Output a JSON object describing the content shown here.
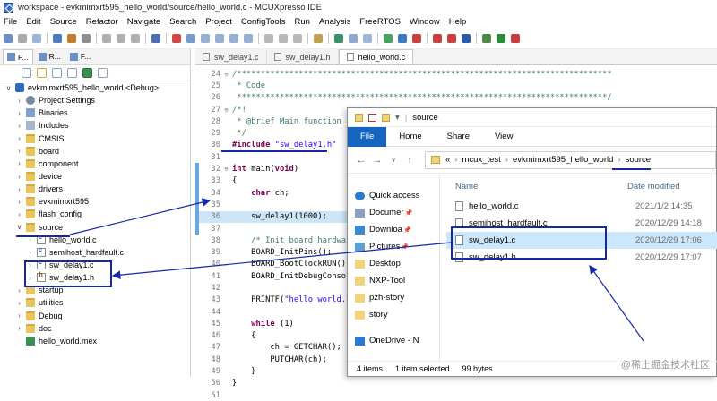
{
  "ide": {
    "title": "workspace - evkmimxrt595_hello_world/source/hello_world.c - MCUXpresso IDE",
    "menu": [
      "File",
      "Edit",
      "Source",
      "Refactor",
      "Navigate",
      "Search",
      "Project",
      "ConfigTools",
      "Run",
      "Analysis",
      "FreeRTOS",
      "Window",
      "Help"
    ]
  },
  "left_panel": {
    "tabs": [
      {
        "label": "P..."
      },
      {
        "label": "R..."
      },
      {
        "label": "F..."
      }
    ],
    "tree": [
      {
        "label": "evkmimxrt595_hello_world <Debug>",
        "indent": 0,
        "caret": "v",
        "icon": "proj"
      },
      {
        "label": "Project Settings",
        "indent": 1,
        "caret": ">",
        "icon": "gear"
      },
      {
        "label": "Binaries",
        "indent": 1,
        "caret": ">",
        "icon": "bin"
      },
      {
        "label": "Includes",
        "indent": 1,
        "caret": ">",
        "icon": "inc"
      },
      {
        "label": "CMSIS",
        "indent": 1,
        "caret": ">",
        "icon": "folder"
      },
      {
        "label": "board",
        "indent": 1,
        "caret": ">",
        "icon": "folder"
      },
      {
        "label": "component",
        "indent": 1,
        "caret": ">",
        "icon": "folder"
      },
      {
        "label": "device",
        "indent": 1,
        "caret": ">",
        "icon": "folder"
      },
      {
        "label": "drivers",
        "indent": 1,
        "caret": ">",
        "icon": "folder"
      },
      {
        "label": "evkmimxrt595",
        "indent": 1,
        "caret": ">",
        "icon": "folder"
      },
      {
        "label": "flash_config",
        "indent": 1,
        "caret": ">",
        "icon": "folder"
      },
      {
        "label": "source",
        "indent": 1,
        "caret": "v",
        "icon": "srcfolder"
      },
      {
        "label": "hello_world.c",
        "indent": 2,
        "caret": ">",
        "icon": "file"
      },
      {
        "label": "semihost_hardfault.c",
        "indent": 2,
        "caret": ">",
        "icon": "file"
      },
      {
        "label": "sw_delay1.c",
        "indent": 2,
        "caret": ">",
        "icon": "file"
      },
      {
        "label": "sw_delay1.h",
        "indent": 2,
        "caret": ">",
        "icon": "hfile"
      },
      {
        "label": "startup",
        "indent": 1,
        "caret": ">",
        "icon": "folder"
      },
      {
        "label": "utilities",
        "indent": 1,
        "caret": ">",
        "icon": "folder"
      },
      {
        "label": "Debug",
        "indent": 1,
        "caret": ">",
        "icon": "folder"
      },
      {
        "label": "doc",
        "indent": 1,
        "caret": ">",
        "icon": "folder"
      },
      {
        "label": "hello_world.mex",
        "indent": 1,
        "caret": "",
        "icon": "mex"
      }
    ]
  },
  "editor": {
    "tabs": [
      {
        "label": "sw_delay1.c",
        "active": false
      },
      {
        "label": "sw_delay1.h",
        "active": false
      },
      {
        "label": "hello_world.c",
        "active": true
      }
    ],
    "lines": [
      {
        "n": "24",
        "fold": "⊖",
        "segs": [
          {
            "t": "/*******************************************************************************",
            "c": "comment"
          }
        ]
      },
      {
        "n": "25",
        "fold": "",
        "segs": [
          {
            "t": " * Code",
            "c": "comment"
          }
        ]
      },
      {
        "n": "26",
        "fold": "",
        "segs": [
          {
            "t": " ******************************************************************************/",
            "c": "comment"
          }
        ]
      },
      {
        "n": "27",
        "fold": "⊖",
        "segs": [
          {
            "t": "/*!",
            "c": "comment"
          }
        ]
      },
      {
        "n": "28",
        "fold": "",
        "segs": [
          {
            "t": " * @brief Main function",
            "c": "comment"
          }
        ]
      },
      {
        "n": "29",
        "fold": "",
        "segs": [
          {
            "t": " */",
            "c": "comment"
          }
        ]
      },
      {
        "n": "30",
        "fold": "",
        "segs": [
          {
            "t": "#include ",
            "c": "kw"
          },
          {
            "t": "\"sw_delay1.h\"",
            "c": "str"
          }
        ]
      },
      {
        "n": "31",
        "fold": "",
        "segs": []
      },
      {
        "n": "32",
        "fold": "⊖",
        "segs": [
          {
            "t": "int ",
            "c": "kw"
          },
          {
            "t": "main(",
            "c": "plain"
          },
          {
            "t": "void",
            "c": "kw"
          },
          {
            "t": ")",
            "c": "plain"
          }
        ]
      },
      {
        "n": "33",
        "fold": "",
        "segs": [
          {
            "t": "{",
            "c": "plain"
          }
        ]
      },
      {
        "n": "34",
        "fold": "",
        "segs": [
          {
            "t": "    ",
            "c": "plain"
          },
          {
            "t": "char ",
            "c": "kw"
          },
          {
            "t": "ch;",
            "c": "plain"
          }
        ]
      },
      {
        "n": "35",
        "fold": "",
        "segs": []
      },
      {
        "n": "36",
        "fold": "",
        "hl": true,
        "segs": [
          {
            "t": "    sw_delay1(1000);",
            "c": "plain"
          }
        ]
      },
      {
        "n": "37",
        "fold": "",
        "segs": []
      },
      {
        "n": "38",
        "fold": "",
        "segs": [
          {
            "t": "    /* Init board hardware. */",
            "c": "comment"
          }
        ]
      },
      {
        "n": "39",
        "fold": "",
        "segs": [
          {
            "t": "    BOARD_InitPins();",
            "c": "plain"
          }
        ]
      },
      {
        "n": "40",
        "fold": "",
        "segs": [
          {
            "t": "    BOARD_BootClockRUN();",
            "c": "plain"
          }
        ]
      },
      {
        "n": "41",
        "fold": "",
        "segs": [
          {
            "t": "    BOARD_InitDebugConsole();",
            "c": "plain"
          }
        ]
      },
      {
        "n": "42",
        "fold": "",
        "segs": []
      },
      {
        "n": "43",
        "fold": "",
        "segs": [
          {
            "t": "    PRINTF(",
            "c": "plain"
          },
          {
            "t": "\"hello world.\\r\\n\"",
            "c": "str"
          },
          {
            "t": ");",
            "c": "plain"
          }
        ]
      },
      {
        "n": "44",
        "fold": "",
        "segs": []
      },
      {
        "n": "45",
        "fold": "",
        "segs": [
          {
            "t": "    ",
            "c": "plain"
          },
          {
            "t": "while ",
            "c": "kw"
          },
          {
            "t": "(1)",
            "c": "plain"
          }
        ]
      },
      {
        "n": "46",
        "fold": "",
        "segs": [
          {
            "t": "    {",
            "c": "plain"
          }
        ]
      },
      {
        "n": "47",
        "fold": "",
        "segs": [
          {
            "t": "        ch = GETCHAR();",
            "c": "plain"
          }
        ]
      },
      {
        "n": "48",
        "fold": "",
        "segs": [
          {
            "t": "        PUTCHAR(ch);",
            "c": "plain"
          }
        ]
      },
      {
        "n": "49",
        "fold": "",
        "segs": [
          {
            "t": "    }",
            "c": "plain"
          }
        ]
      },
      {
        "n": "50",
        "fold": "",
        "segs": [
          {
            "t": "}",
            "c": "plain"
          }
        ]
      },
      {
        "n": "51",
        "fold": "",
        "segs": []
      }
    ]
  },
  "explorer": {
    "title": "source",
    "ribbon": [
      "File",
      "Home",
      "Share",
      "View"
    ],
    "breadcrumb": [
      "«",
      "mcux_test",
      "evkmimxrt595_hello_world",
      "source"
    ],
    "nav": [
      {
        "label": "Quick access",
        "pin": false
      },
      {
        "label": "Documer",
        "pin": true
      },
      {
        "label": "Downloa",
        "pin": true
      },
      {
        "label": "Pictures",
        "pin": true
      },
      {
        "label": "Desktop",
        "pin": false
      },
      {
        "label": "NXP-Tool",
        "pin": false
      },
      {
        "label": "pzh-story",
        "pin": false
      },
      {
        "label": "story",
        "pin": false
      },
      {
        "label": "OneDrive - N",
        "pin": false
      }
    ],
    "columns": {
      "name": "Name",
      "date": "Date modified"
    },
    "files": [
      {
        "name": "hello_world.c",
        "date": "2021/1/2 14:35"
      },
      {
        "name": "semihost_hardfault.c",
        "date": "2020/12/29 14:18"
      },
      {
        "name": "sw_delay1.c",
        "date": "2020/12/29 17:06"
      },
      {
        "name": "sw_delay1.h",
        "date": "2020/12/29 17:07"
      }
    ],
    "status": {
      "items": "4 items",
      "selected": "1 item selected",
      "size": "99 bytes"
    }
  },
  "watermark": "@稀土掘金技术社区",
  "colors": {
    "annotation": "#1528a8",
    "ribbon_file": "#1565c0",
    "selection": "#cce8ff"
  }
}
